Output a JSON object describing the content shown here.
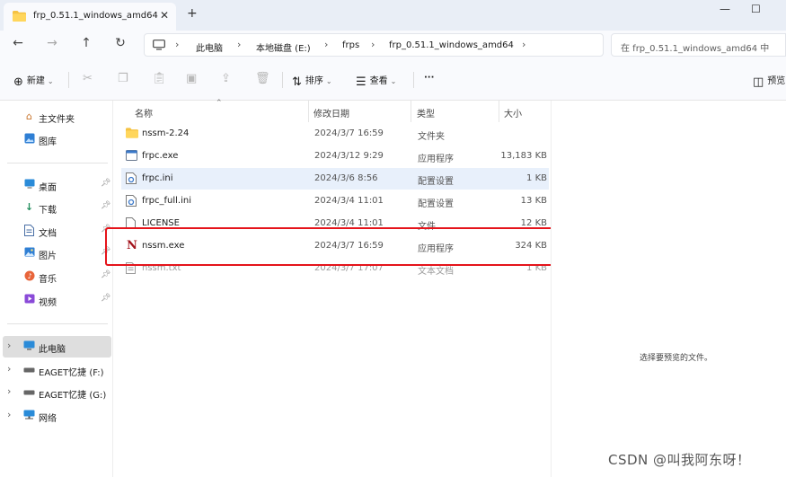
{
  "window": {
    "tab_title": "frp_0.51.1_windows_amd64",
    "new_tab": "+",
    "tab_close": "✕",
    "minimize": "—",
    "maximize": "☐"
  },
  "address": {
    "crumbs": [
      "此电脑",
      "本地磁盘 (E:)",
      "frps",
      "frp_0.51.1_windows_amd64"
    ],
    "search_placeholder": "在 frp_0.51.1_windows_amd64 中"
  },
  "toolbar": {
    "new_label": "新建",
    "sort_label": "排序",
    "view_label": "查看",
    "more_label": "···",
    "preview_label": "预览"
  },
  "sidebar": {
    "top": [
      {
        "label": "主文件夹",
        "icon": "home-icon"
      },
      {
        "label": "图库",
        "icon": "gallery-icon"
      }
    ],
    "pinned": [
      {
        "label": "桌面",
        "icon": "desktop-icon"
      },
      {
        "label": "下载",
        "icon": "download-icon"
      },
      {
        "label": "文档",
        "icon": "documents-icon"
      },
      {
        "label": "图片",
        "icon": "pictures-icon"
      },
      {
        "label": "音乐",
        "icon": "music-icon"
      },
      {
        "label": "视频",
        "icon": "videos-icon"
      }
    ],
    "drives": [
      {
        "label": "此电脑",
        "icon": "this-pc-icon",
        "selected": true
      },
      {
        "label": "EAGET忆捷 (F:)",
        "icon": "drive-icon"
      },
      {
        "label": "EAGET忆捷 (G:)",
        "icon": "drive-icon"
      },
      {
        "label": "网络",
        "icon": "network-icon"
      }
    ]
  },
  "columns": {
    "name": "名称",
    "date": "修改日期",
    "type": "类型",
    "size": "大小"
  },
  "files": [
    {
      "name": "nssm-2.24",
      "date": "2024/3/7 16:59",
      "type": "文件夹",
      "size": "",
      "icon": "folder-icon"
    },
    {
      "name": "frpc.exe",
      "date": "2024/3/12 9:29",
      "type": "应用程序",
      "size": "13,183 KB",
      "icon": "exe-icon"
    },
    {
      "name": "frpc.ini",
      "date": "2024/3/6 8:56",
      "type": "配置设置",
      "size": "1 KB",
      "icon": "ini-icon"
    },
    {
      "name": "frpc_full.ini",
      "date": "2024/3/4 11:01",
      "type": "配置设置",
      "size": "13 KB",
      "icon": "ini-icon"
    },
    {
      "name": "LICENSE",
      "date": "2024/3/4 11:01",
      "type": "文件",
      "size": "12 KB",
      "icon": "file-icon"
    },
    {
      "name": "nssm.exe",
      "date": "2024/3/7 16:59",
      "type": "应用程序",
      "size": "324 KB",
      "icon": "nssm-icon"
    },
    {
      "name": "nssm.txt",
      "date": "2024/3/7 17:07",
      "type": "文本文档",
      "size": "1 KB",
      "icon": "text-file-icon"
    }
  ],
  "preview": {
    "message": "选择要预览的文件。"
  },
  "watermark": "CSDN @叫我阿东呀！",
  "colors": {
    "accent": "#0067c0",
    "highlight_box": "#e5141b",
    "folder": "#f5c242"
  }
}
